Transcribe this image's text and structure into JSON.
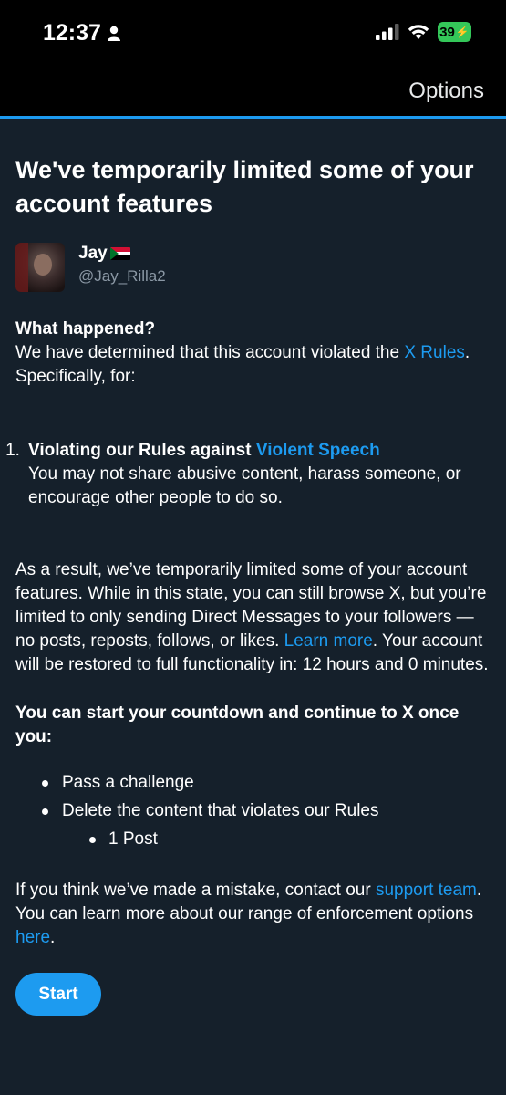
{
  "status_bar": {
    "time": "12:37",
    "battery": "39",
    "icons": [
      "person-icon",
      "signal-icon",
      "wifi-icon",
      "battery-icon"
    ]
  },
  "header": {
    "options_label": "Options"
  },
  "notice": {
    "title": "We've temporarily limited some of your account features",
    "user": {
      "name": "Jay",
      "handle": "@Jay_Rilla2"
    },
    "what_happened": {
      "heading": "What happened?",
      "text_before": "We have determined that this account violated the ",
      "link": "X Rules",
      "text_after": ". Specifically, for:"
    },
    "violation": {
      "number": "1.",
      "title_prefix": "Violating our Rules against ",
      "title_link": "Violent Speech",
      "description": "You may not share abusive content, harass someone, or encourage other people to do so."
    },
    "result": {
      "text_before": "As a result, we’ve temporarily limited some of your account features. While in this state, you can still browse X, but you’re limited to only sending Direct Messages to your followers — no posts, reposts, follows, or likes. ",
      "link": "Learn more",
      "text_after": ". Your account will be restored to full functionality in: 12 hours and 0 minutes."
    },
    "countdown": {
      "heading": "You can start your countdown and continue to X once you:",
      "items": [
        "Pass a challenge",
        "Delete the content that violates our Rules"
      ],
      "sub_items": [
        "1 Post"
      ]
    },
    "mistake": {
      "text_before": "If you think we’ve made a mistake, contact our ",
      "link1": "support team",
      "text_middle": ". You can learn more about our range of enforcement options ",
      "link2": "here",
      "text_after": "."
    },
    "start_label": "Start"
  },
  "colors": {
    "background": "#15202b",
    "accent": "#1d9bf0",
    "battery": "#34c759"
  }
}
